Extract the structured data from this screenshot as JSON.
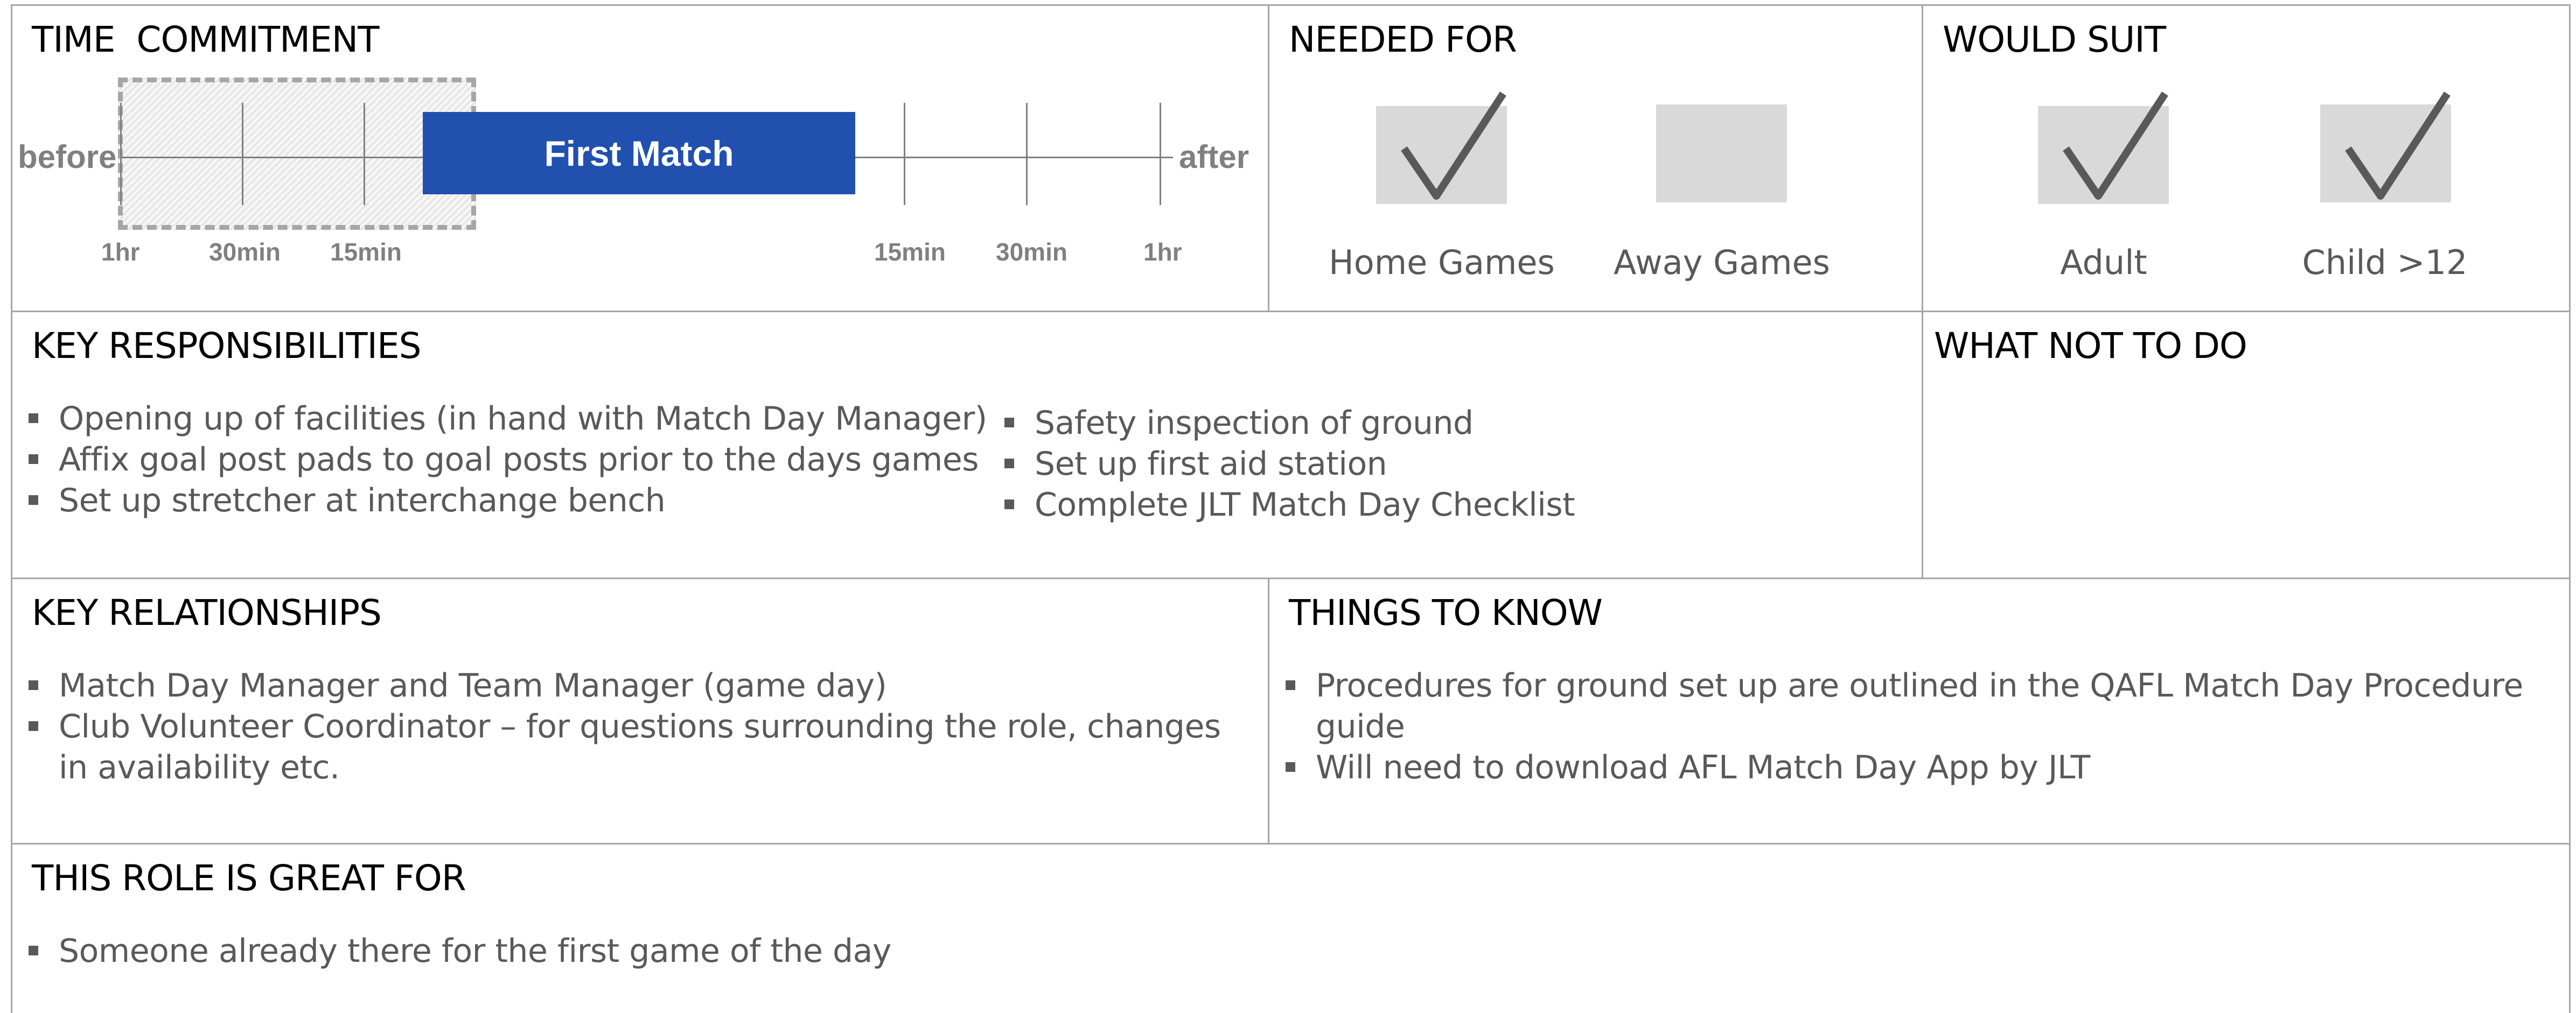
{
  "time_commitment": {
    "heading": "TIME  COMMITMENT",
    "before_label": "before",
    "after_label": "after",
    "match_label": "First Match",
    "before_ticks": [
      "1hr",
      "30min",
      "15min"
    ],
    "after_ticks": [
      "15min",
      "30min",
      "1hr"
    ],
    "match_color": "#2150af"
  },
  "needed_for": {
    "heading": "NEEDED FOR",
    "options": [
      {
        "label": "Home Games",
        "checked": true,
        "icon": "check-icon"
      },
      {
        "label": "Away Games",
        "checked": false,
        "icon": "empty-box-icon"
      }
    ]
  },
  "would_suit": {
    "heading": "WOULD SUIT",
    "options": [
      {
        "label": "Adult",
        "checked": true,
        "icon": "check-icon"
      },
      {
        "label": "Child >12",
        "checked": true,
        "icon": "check-icon"
      }
    ]
  },
  "key_responsibilities": {
    "heading": "KEY RESPONSIBILITIES",
    "col1": [
      "Opening up of facilities (in hand with Match Day Manager)",
      "Affix goal post pads to goal posts prior to the days games",
      "Set up stretcher at interchange bench"
    ],
    "col2": [
      "Safety inspection of ground",
      "Set up first aid station",
      "Complete JLT Match Day Checklist"
    ]
  },
  "what_not_to_do": {
    "heading": "WHAT NOT TO DO"
  },
  "key_relationships": {
    "heading": "KEY RELATIONSHIPS",
    "items": [
      "Match Day Manager and Team Manager (game day)",
      "Club Volunteer Coordinator – for questions surrounding the role, changes in availability etc."
    ]
  },
  "things_to_know": {
    "heading": "THINGS TO KNOW",
    "items": [
      "Procedures for ground set up are outlined in the QAFL Match Day Procedure guide",
      "Will need to download AFL Match Day App by JLT"
    ]
  },
  "great_for": {
    "heading": "THIS ROLE IS GREAT FOR",
    "items": [
      "Someone already there for the first game of the day"
    ]
  }
}
